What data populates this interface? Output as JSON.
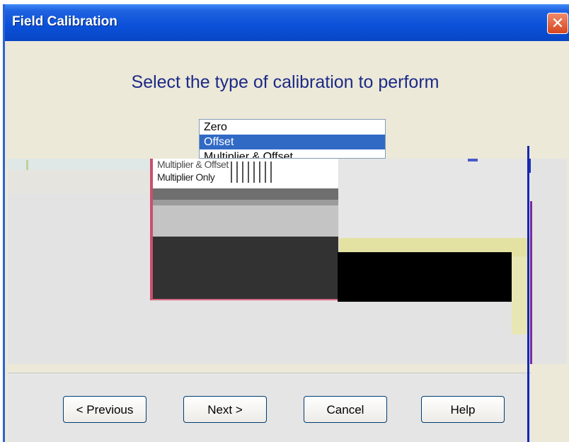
{
  "window": {
    "title": "Field Calibration",
    "close_label": "✕"
  },
  "heading": "Select the type of calibration to perform",
  "calibration_list": {
    "options": [
      "Zero",
      "Offset",
      "Multiplier & Offset"
    ],
    "selected": "Offset"
  },
  "glitch_popup": {
    "line1": "Multiplier & Offset",
    "line2": "Multiplier Only"
  },
  "buttons": {
    "previous": "< Previous",
    "next": "Next >",
    "cancel": "Cancel",
    "help": "Help"
  },
  "colors": {
    "titlebar": "#0a50d8",
    "heading_text": "#1c2a87",
    "selection": "#316ac5",
    "dialog_bg": "#ece9d8"
  },
  "icons": {
    "close": "close-icon"
  }
}
